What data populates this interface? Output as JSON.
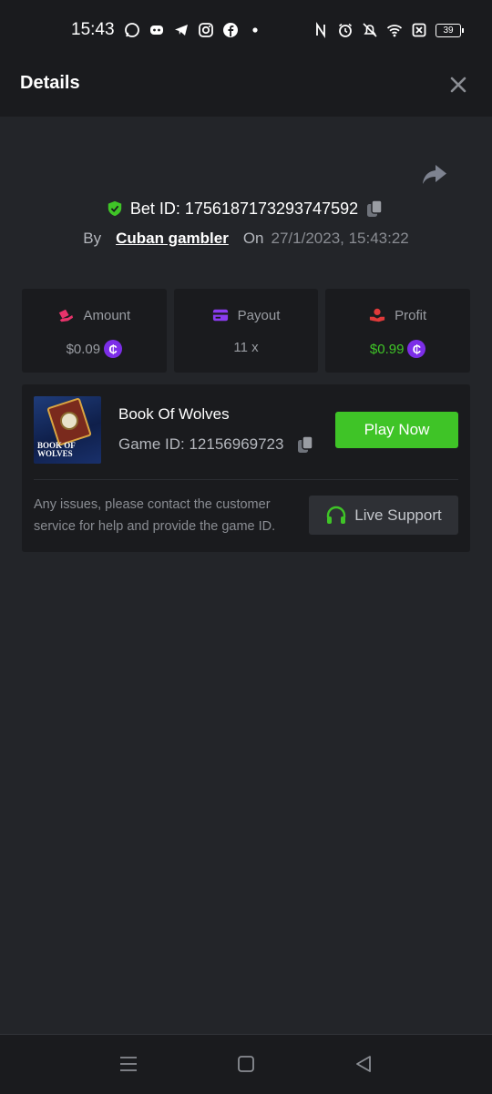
{
  "status_bar": {
    "time": "15:43",
    "left_icons": [
      "whatsapp-icon",
      "discord-icon",
      "telegram-icon",
      "instagram-icon",
      "facebook-icon",
      "dot-icon"
    ],
    "right_icons": [
      "nfc-icon",
      "alarm-icon",
      "mute-icon",
      "wifi-icon",
      "sim-x-icon"
    ],
    "battery": "39"
  },
  "header": {
    "title": "Details"
  },
  "bet": {
    "id_text": "Bet ID: 1756187173293747592",
    "by_label": "By",
    "user": "Cuban gambler",
    "on_label": "On",
    "date": "27/1/2023, 15:43:22"
  },
  "stats": {
    "amount": {
      "label": "Amount",
      "value": "$0.09"
    },
    "payout": {
      "label": "Payout",
      "value": "11 x"
    },
    "profit": {
      "label": "Profit",
      "value": "$0.99"
    },
    "coin_glyph": "₵"
  },
  "game": {
    "thumb_text_1": "BOOK OF",
    "thumb_text_2": "WOLVES",
    "name": "Book Of Wolves",
    "id_text": "Game ID: 12156969723",
    "play_label": "Play Now",
    "help_text": "Any issues, please contact the customer service for help and provide the game ID.",
    "support_label": "Live Support"
  },
  "colors": {
    "accent_green": "#3fc427",
    "coin_purple": "#7c2ee8",
    "amount_pink": "#e8336b",
    "payout_purple": "#8a3cf0",
    "profit_red": "#e03a3a"
  }
}
